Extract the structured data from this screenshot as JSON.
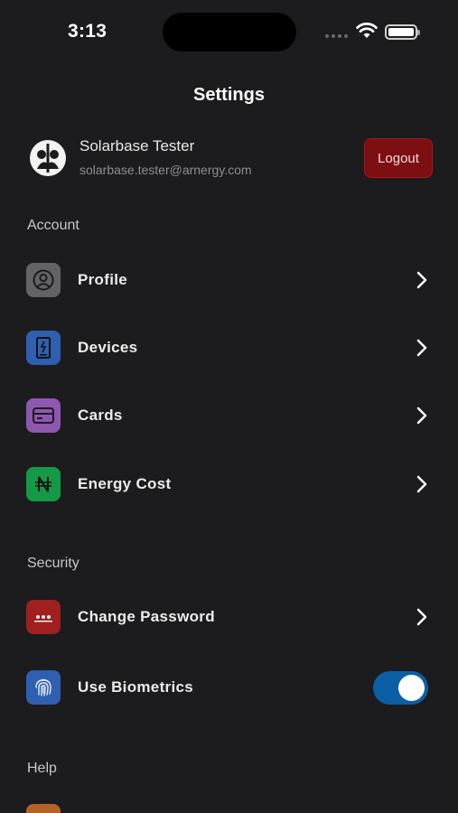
{
  "status_bar": {
    "time": "3:13"
  },
  "page": {
    "title": "Settings"
  },
  "user": {
    "name": "Solarbase Tester",
    "email": "solarbase.tester@arnergy.com",
    "logout_label": "Logout"
  },
  "sections": {
    "account": "Account",
    "security": "Security",
    "help": "Help"
  },
  "account_items": [
    {
      "label": "Profile",
      "icon": "profile-icon",
      "color": "#636366"
    },
    {
      "label": "Devices",
      "icon": "device-icon",
      "color": "#2f5fb0"
    },
    {
      "label": "Cards",
      "icon": "card-icon",
      "color": "#8e58b0"
    },
    {
      "label": "Energy Cost",
      "icon": "naira-icon",
      "color": "#159947"
    }
  ],
  "security_items": [
    {
      "label": "Change Password",
      "icon": "password-icon",
      "color": "#a01f1f"
    },
    {
      "label": "Use Biometrics",
      "icon": "fingerprint-icon",
      "color": "#2f5fb0",
      "toggle_on": true
    }
  ],
  "help_items": [
    {
      "icon_color": "#b5622a"
    }
  ]
}
